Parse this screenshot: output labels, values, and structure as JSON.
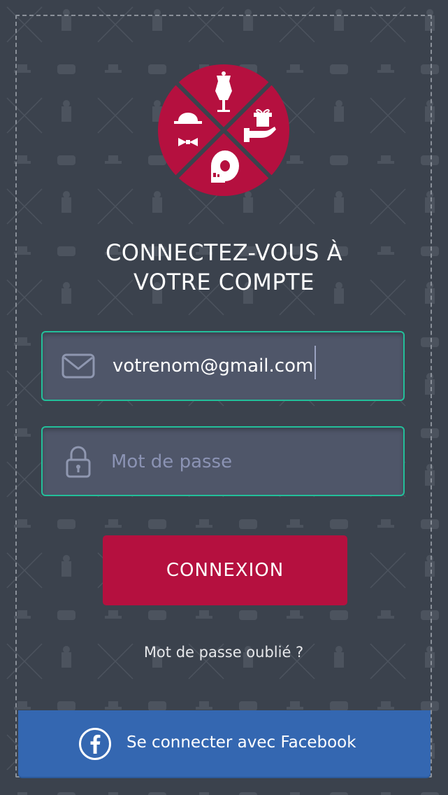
{
  "login": {
    "title_line1": "CONNECTEZ-VOUS À",
    "title_line2": "VOTRE COMPTE",
    "email": {
      "value": "votrenom@gmail.com",
      "icon": "envelope-icon"
    },
    "password": {
      "placeholder": "Mot de passe",
      "icon": "lock-icon"
    },
    "submit_label": "CONNEXION",
    "forgot_label": "Mot de passe oublié ?",
    "facebook_label": "Se connecter avec Facebook",
    "facebook_icon": "facebook-icon"
  },
  "logo": {
    "icons": [
      "mannequin-icon",
      "gift-in-hand-icon",
      "measuring-tape-icon",
      "hat-and-bowtie-icon"
    ]
  },
  "colors": {
    "background": "#3b424d",
    "accent": "#b5103f",
    "field_border": "#23bf9a",
    "field_fill": "#4f5669",
    "facebook": "#3467b1",
    "placeholder": "#8b93b4"
  }
}
